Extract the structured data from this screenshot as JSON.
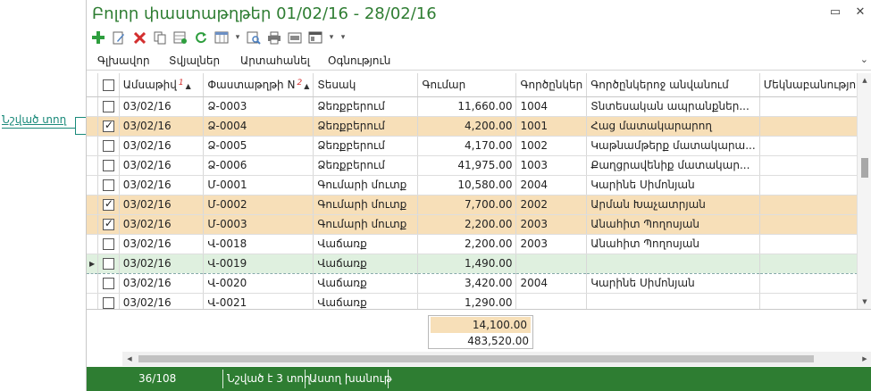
{
  "annotation": {
    "label": "Նշված տող"
  },
  "window": {
    "title": "Բոլոր փաստաթղթեր 01/02/16 - 28/02/16",
    "restore_icon": "▭",
    "close_icon": "✕"
  },
  "toolbar": {
    "icons": [
      "add-icon",
      "edit-icon",
      "delete-icon",
      "copy-icon",
      "select-icon",
      "refresh-icon",
      "columns-icon",
      "preview-icon",
      "print-icon",
      "export-icon",
      "view-icon"
    ],
    "colors": {
      "add": "#2e9e3e",
      "delete": "#d32f2f"
    }
  },
  "menu": {
    "items": [
      "Գլխավոր",
      "Տվյալներ",
      "Արտահանել",
      "Օգնություն"
    ],
    "collapse_icon": "⌄"
  },
  "grid": {
    "columns": [
      "Ամսաթիվ",
      "Փաստաթղթի N",
      "Տեսակ",
      "Գումար",
      "Գործընկեր",
      "Գործընկերոջ անվանում",
      "Մեկնաբանություն"
    ],
    "sort_indices": [
      "1",
      "2"
    ],
    "rows": [
      {
        "checked": false,
        "selected": false,
        "current": false,
        "date": "03/02/16",
        "doc": "Ձ-0003",
        "type": "Ձեռքբերում",
        "amount": "11,660.00",
        "partner": "1004",
        "partner_name": "Տնտեսական ապրանքներ...",
        "comment": ""
      },
      {
        "checked": true,
        "selected": true,
        "current": false,
        "date": "03/02/16",
        "doc": "Ձ-0004",
        "type": "Ձեռքբերում",
        "amount": "4,200.00",
        "partner": "1001",
        "partner_name": "Հաց մատակարարող",
        "comment": ""
      },
      {
        "checked": false,
        "selected": false,
        "current": false,
        "date": "03/02/16",
        "doc": "Ձ-0005",
        "type": "Ձեռքբերում",
        "amount": "4,170.00",
        "partner": "1002",
        "partner_name": "Կաթնամթերք մատակարա...",
        "comment": ""
      },
      {
        "checked": false,
        "selected": false,
        "current": false,
        "date": "03/02/16",
        "doc": "Ձ-0006",
        "type": "Ձեռքբերում",
        "amount": "41,975.00",
        "partner": "1003",
        "partner_name": "Քաղցրավենիք մատակար...",
        "comment": ""
      },
      {
        "checked": false,
        "selected": false,
        "current": false,
        "date": "03/02/16",
        "doc": "Մ-0001",
        "type": "Գումարի մուտք",
        "amount": "10,580.00",
        "partner": "2004",
        "partner_name": "Կարինե Սիմոնյան",
        "comment": ""
      },
      {
        "checked": true,
        "selected": true,
        "current": false,
        "date": "03/02/16",
        "doc": "Մ-0002",
        "type": "Գումարի մուտք",
        "amount": "7,700.00",
        "partner": "2002",
        "partner_name": "Արման Խաչատրյան",
        "comment": ""
      },
      {
        "checked": true,
        "selected": true,
        "current": false,
        "date": "03/02/16",
        "doc": "Մ-0003",
        "type": "Գումարի մուտք",
        "amount": "2,200.00",
        "partner": "2003",
        "partner_name": "Անահիտ Պողոսյան",
        "comment": ""
      },
      {
        "checked": false,
        "selected": false,
        "current": false,
        "date": "03/02/16",
        "doc": "Վ-0018",
        "type": "Վաճառք",
        "amount": "2,200.00",
        "partner": "2003",
        "partner_name": "Անահիտ Պողոսյան",
        "comment": ""
      },
      {
        "checked": false,
        "selected": false,
        "current": true,
        "date": "03/02/16",
        "doc": "Վ-0019",
        "type": "Վաճառք",
        "amount": "1,490.00",
        "partner": "",
        "partner_name": "",
        "comment": ""
      },
      {
        "checked": false,
        "selected": false,
        "current": false,
        "date": "03/02/16",
        "doc": "Վ-0020",
        "type": "Վաճառք",
        "amount": "3,420.00",
        "partner": "2004",
        "partner_name": "Կարինե Սիմոնյան",
        "comment": ""
      },
      {
        "checked": false,
        "selected": false,
        "current": false,
        "date": "03/02/16",
        "doc": "Վ-0021",
        "type": "Վաճառք",
        "amount": "1,290.00",
        "partner": "",
        "partner_name": "",
        "comment": ""
      }
    ]
  },
  "totals": {
    "selected_sum": "14,100.00",
    "total_sum": "483,520.00"
  },
  "status": {
    "position": "36/108",
    "selected": "Նշված է 3 տող",
    "close": "Աստղ խանութ"
  }
}
